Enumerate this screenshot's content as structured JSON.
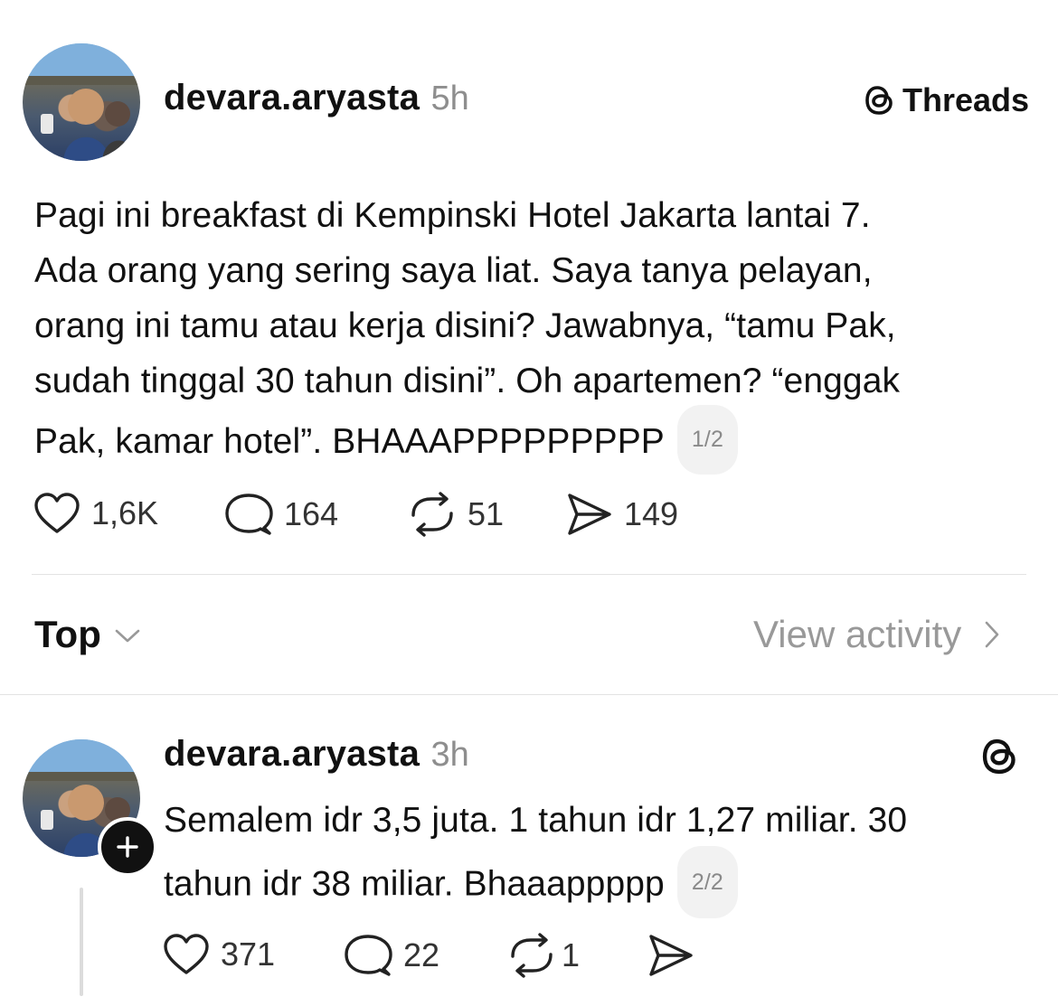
{
  "brand": {
    "label": "Threads"
  },
  "post": {
    "username": "devara.aryasta",
    "time": "5h",
    "lines": [
      "Pagi ini breakfast di Kempinski Hotel Jakarta lantai 7.",
      "Ada orang yang sering saya liat. Saya tanya pelayan,",
      "orang ini tamu atau kerja disini? Jawabnya, “tamu Pak,",
      "sudah tinggal 30 tahun disini”. Oh apartemen? “enggak",
      "Pak, kamar hotel”. BHAAAPPPPPPPPP"
    ],
    "thread_position": "1/2",
    "stats": {
      "likes": "1,6K",
      "replies": "164",
      "reposts": "51",
      "shares": "149"
    }
  },
  "sort": {
    "label": "Top",
    "view_activity": "View activity"
  },
  "reply": {
    "username": "devara.aryasta",
    "time": "3h",
    "lines": [
      "Semalem idr 3,5 juta. 1 tahun idr 1,27 miliar. 30",
      "tahun idr 38 miliar. Bhaaappppp"
    ],
    "thread_position": "2/2",
    "stats": {
      "likes": "371",
      "replies": "22",
      "reposts": "1"
    }
  },
  "icons": {
    "brand": "threads-logo-icon",
    "like": "heart-icon",
    "reply": "comment-icon",
    "repost": "repost-icon",
    "share": "send-icon",
    "sort": "chevron-down-icon",
    "activity": "chevron-right-icon",
    "follow": "plus-icon"
  }
}
